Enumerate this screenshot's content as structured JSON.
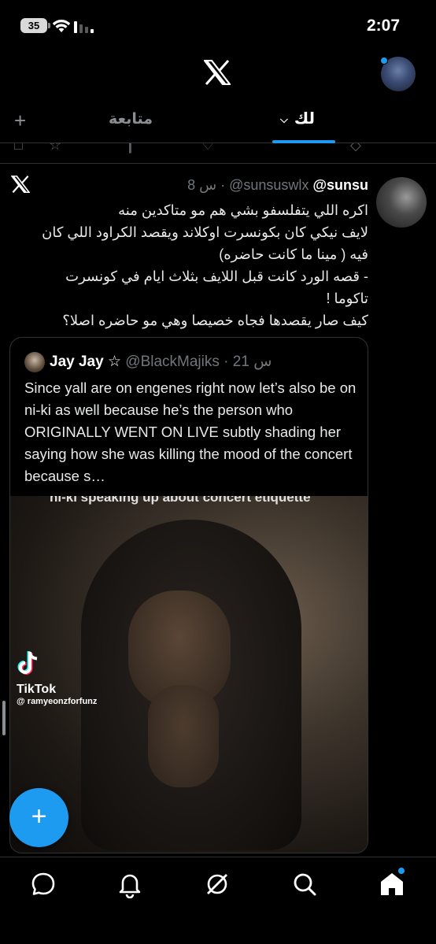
{
  "status_bar": {
    "battery": "35",
    "time": "2:07"
  },
  "header": {
    "logo": "x-logo"
  },
  "tabs": {
    "following": "متابعة",
    "for_you": "لك",
    "add": "+"
  },
  "tweet": {
    "handle": "@sunsu",
    "username": "@sunsuswlx",
    "time": "8 س",
    "body_lines": [
      "اكره اللي يتفلسفو بشي هم مو متاكدين منه",
      "لايف نيكي كان بكونسرت اوكلاند ويقصد الكراود اللي كان",
      "فيه ( مينا ما كانت حاضره)",
      "- قصه  الورد كانت قبل اللايف بثلاث ايام في كونسرت",
      "تاكوما !",
      "كيف صار يقصدها فجاه خصيصا وهي مو حاضره اصلا؟"
    ]
  },
  "quote": {
    "name": "Jay Jay ☆",
    "username": "@BlackMajiks",
    "time": "21 س",
    "text": "Since yall are on  engenes right now let’s also be on ni-ki as well because he’s the person who ORIGINALLY WENT ON LIVE subtly shading her saying how she was killing the mood of the concert because s…",
    "video_caption": "ni-ki speaking up about concert etiquette",
    "tiktok_label": "TikTok",
    "tiktok_user": "@ ramyeonzforfunz"
  },
  "fab": {
    "label": "+"
  },
  "colors": {
    "accent": "#1d9bf0",
    "background": "#000000",
    "muted": "#71767b"
  },
  "bottom_nav": [
    "messages-icon",
    "notifications-icon",
    "grok-icon",
    "search-icon",
    "home-icon"
  ]
}
